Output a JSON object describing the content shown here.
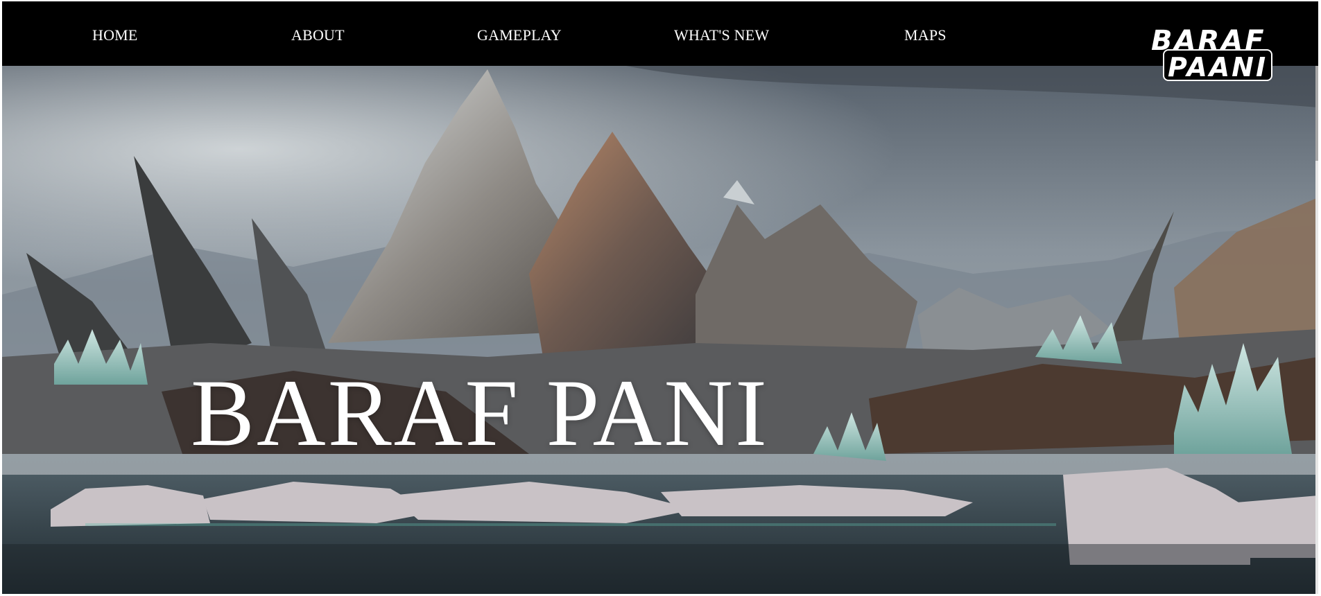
{
  "nav": {
    "items": [
      {
        "label": "HOME"
      },
      {
        "label": "ABOUT"
      },
      {
        "label": "GAMEPLAY"
      },
      {
        "label": "WHAT'S NEW"
      },
      {
        "label": "MAPS"
      }
    ]
  },
  "logo": {
    "line1": "BARAF",
    "line2": "PAANI"
  },
  "hero": {
    "title": "BARAF PANI",
    "image_icon": "icy-mountain-landscape"
  },
  "colors": {
    "navbar": "#000000",
    "text": "#ffffff",
    "sky": "#7d8791",
    "water": "#2d3a40",
    "crystal": "#9cc7c2"
  }
}
